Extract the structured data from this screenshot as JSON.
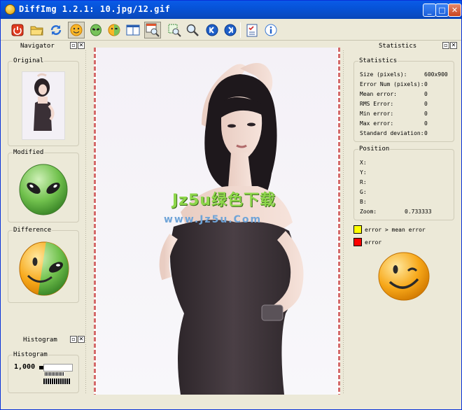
{
  "window": {
    "title": "DiffImg 1.2.1: 10.jpg/12.gif"
  },
  "title_buttons": {
    "minimize": "_",
    "maximize": "□",
    "close": "✕"
  },
  "toolbar": {
    "tools": [
      "quit-icon",
      "open-folder-icon",
      "refresh-icon",
      "smiley-icon",
      "alien-icon",
      "blend-icon",
      "split-view-icon",
      "zoom-window-icon",
      "fit-icon",
      "zoom-icon",
      "previous-icon",
      "next-icon",
      "checklist-icon",
      "info-icon"
    ]
  },
  "navigator": {
    "title": "Navigator",
    "original_label": "Original",
    "modified_label": "Modified",
    "difference_label": "Difference"
  },
  "histogram": {
    "title": "Histogram",
    "group_label": "Histogram",
    "value": "1,000"
  },
  "statistics": {
    "title": "Statistics",
    "group_label": "Statistics",
    "rows": [
      {
        "label": "Size (pixels):",
        "value": "600x900"
      },
      {
        "label": "Error Num (pixels):",
        "value": "0"
      },
      {
        "label": "Mean error:",
        "value": "0"
      },
      {
        "label": "RMS Error:",
        "value": "0"
      },
      {
        "label": "Min error:",
        "value": "0"
      },
      {
        "label": "Max error:",
        "value": "0"
      },
      {
        "label": "Standard deviation:",
        "value": "0"
      }
    ]
  },
  "position": {
    "group_label": "Position",
    "rows": [
      {
        "label": "X:",
        "value": ""
      },
      {
        "label": "Y:",
        "value": ""
      },
      {
        "label": "R:",
        "value": ""
      },
      {
        "label": "G:",
        "value": ""
      },
      {
        "label": "B:",
        "value": ""
      },
      {
        "label": "Zoom:",
        "value": "0.733333"
      }
    ]
  },
  "legend": [
    {
      "color": "#FFFF00",
      "label": "error > mean error"
    },
    {
      "color": "#FF0000",
      "label": "error"
    }
  ],
  "watermark": {
    "line1": "Jz5u绿色下载",
    "line2": "www.Jz5u.Com"
  },
  "colors": {
    "titlebar": "#0A5BE8",
    "panel": "#ECE9D8",
    "legend_yellow": "#FFFF00",
    "legend_red": "#FF0000"
  }
}
